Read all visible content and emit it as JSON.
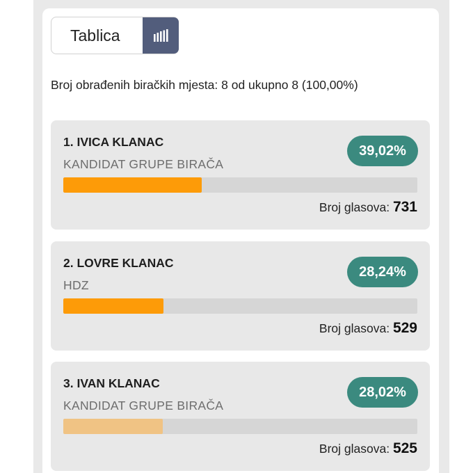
{
  "toggle": {
    "label": "Tablica",
    "chart_icon": "bar-chart-icon"
  },
  "status": "Broj obrađenih biračkih mjesta: 8 od ukupno 8 (100,00%)",
  "votes_label": "Broj glasova:",
  "colors": {
    "accent": "#3b8a7f",
    "bar_primary": "#fd9b08",
    "bar_muted": "#f0c384",
    "toggle_active": "#525d7c"
  },
  "candidates": [
    {
      "name": "1. IVICA KLANAC",
      "party": "KANDIDAT GRUPE BIRAČA",
      "percent": "39,02%",
      "share": 0.3902,
      "votes": "731",
      "bar_color": "#fd9b08"
    },
    {
      "name": "2. LOVRE KLANAC",
      "party": "HDZ",
      "percent": "28,24%",
      "share": 0.2824,
      "votes": "529",
      "bar_color": "#fd9b08"
    },
    {
      "name": "3. IVAN KLANAC",
      "party": "KANDIDAT GRUPE BIRAČA",
      "percent": "28,02%",
      "share": 0.2802,
      "votes": "525",
      "bar_color": "#f0c384"
    }
  ]
}
